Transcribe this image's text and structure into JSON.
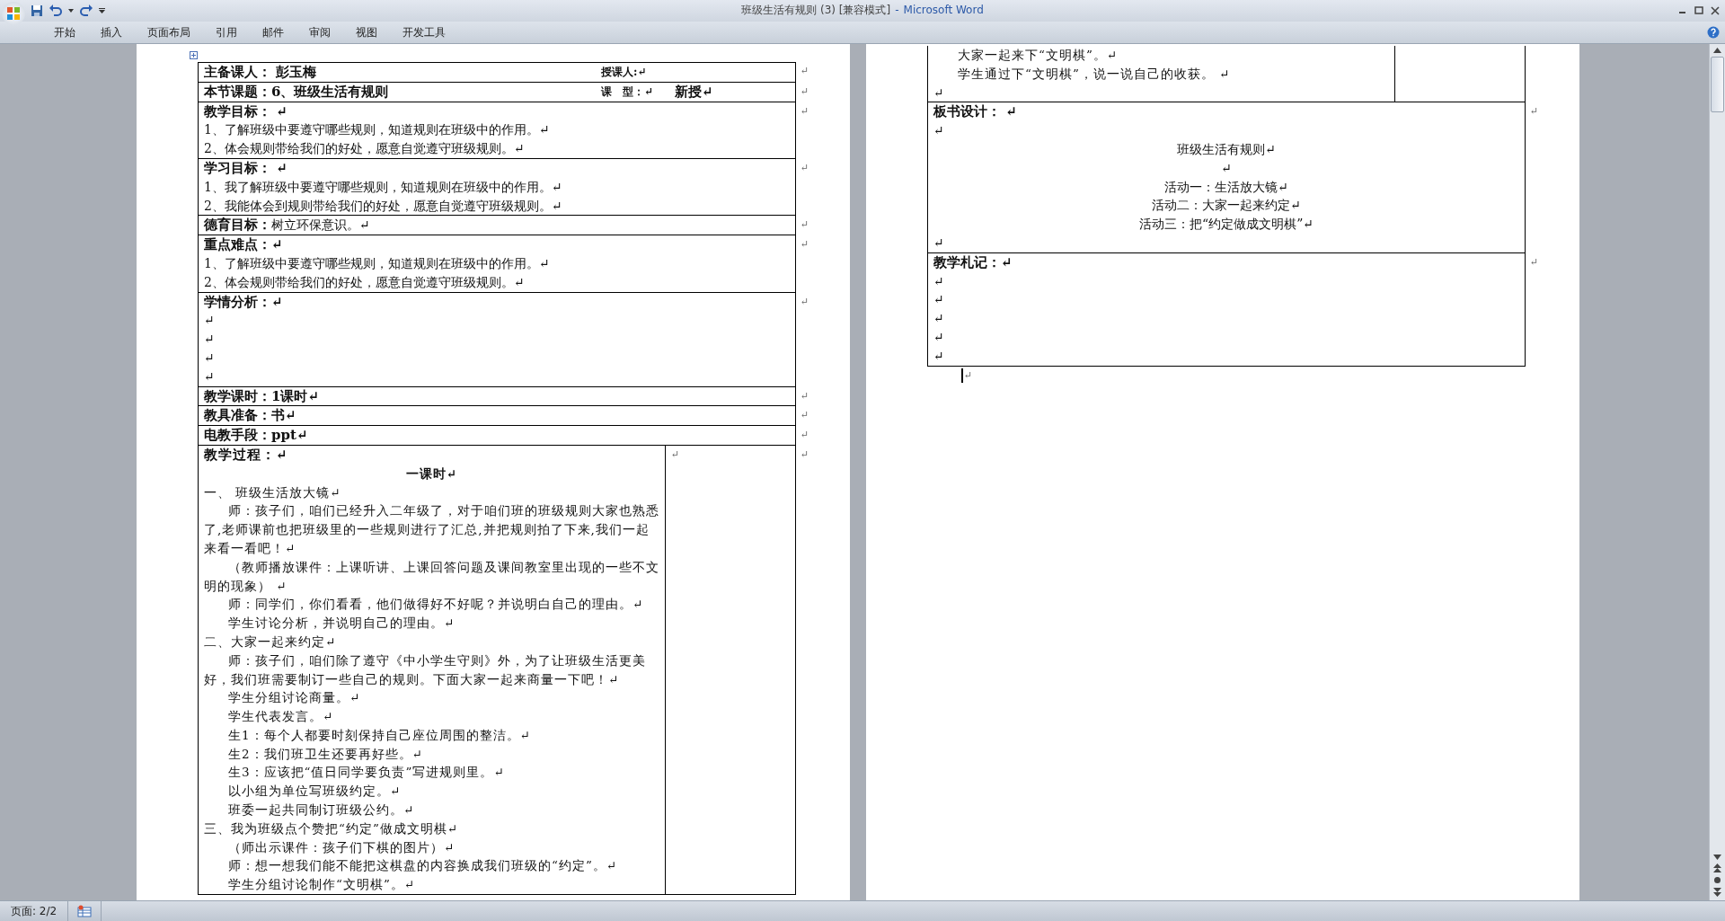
{
  "window": {
    "title": "班级生活有规则 (3) [兼容模式]",
    "separator": "-",
    "app_name": "Microsoft Word"
  },
  "ribbon_tabs": [
    "开始",
    "插入",
    "页面布局",
    "引用",
    "邮件",
    "审阅",
    "视图",
    "开发工具"
  ],
  "left_page": {
    "rows": [
      {
        "kind": "pair",
        "left": "主备课人：  彭玉梅",
        "right": [
          "授课人:↵"
        ],
        "end_mark": "↵"
      },
      {
        "kind": "pair",
        "left": "本节课题：6、班级生活有规则",
        "right": [
          "课　型：↵",
          "新授↵"
        ],
        "end_mark": "↵"
      },
      {
        "kind": "block",
        "heading": "教学目标：  ↵",
        "lines": [
          "1、了解班级中要遵守哪些规则，知道规则在班级中的作用。↵",
          "2、体会规则带给我们的好处，愿意自觉遵守班级规则。↵"
        ],
        "end_mark": "↵"
      },
      {
        "kind": "block",
        "heading": "学习目标：  ↵",
        "lines": [
          "1、我了解班级中要遵守哪些规则，知道规则在班级中的作用。↵",
          "2、我能体会到规则带给我们的好处，愿意自觉遵守班级规则。↵"
        ],
        "end_mark": "↵"
      },
      {
        "kind": "line",
        "heading": "德育目标：",
        "text": "树立环保意识。↵",
        "end_mark": "↵"
      },
      {
        "kind": "block",
        "heading": "重点难点：↵",
        "lines": [
          "1、了解班级中要遵守哪些规则，知道规则在班级中的作用。↵",
          "2、体会规则带给我们的好处，愿意自觉遵守班级规则。↵"
        ],
        "end_mark": "↵"
      },
      {
        "kind": "block",
        "heading": "学情分析：↵",
        "lines": [
          "↵",
          "↵",
          "↵",
          "↵"
        ],
        "end_mark": "↵"
      },
      {
        "kind": "line",
        "heading": "教学课时：1课时↵",
        "end_mark": "↵"
      },
      {
        "kind": "line",
        "heading": "教具准备：书↵",
        "end_mark": "↵"
      },
      {
        "kind": "line",
        "heading": "电教手段：ppt↵",
        "end_mark": "↵"
      },
      {
        "kind": "process",
        "heading": "教学过程：↵",
        "subtitle": "一课时↵",
        "side": "↵",
        "end_mark": "↵",
        "paragraphs": [
          {
            "kind": "plain",
            "text": "一、  班级生活放大镜↵"
          },
          {
            "kind": "indented",
            "text": "师：孩子们，咱们已经升入二年级了，对于咱们班的班级规则大家也熟悉了,老师课前也把班级里的一些规则进行了汇总,并把规则拍了下来,我们一起来看一看吧！↵"
          },
          {
            "kind": "indented",
            "text": "（教师播放课件：上课听讲、上课回答问题及课间教室里出现的一些不文明的现象）  ↵"
          },
          {
            "kind": "indented",
            "text": "师：同学们，你们看看，他们做得好不好呢？并说明白自己的理由。↵"
          },
          {
            "kind": "indented",
            "text": " 学生讨论分析，并说明自己的理由。↵"
          },
          {
            "kind": "plain",
            "text": "二、大家一起来约定↵"
          },
          {
            "kind": "indented",
            "text": "师：孩子们，咱们除了遵守《中小学生守则》外，为了让班级生活更美好，我们班需要制订一些自己的规则。下面大家一起来商量一下吧！↵"
          },
          {
            "kind": "indented",
            "text": "学生分组讨论商量。↵"
          },
          {
            "kind": "indented",
            "text": "学生代表发言。↵"
          },
          {
            "kind": "indented",
            "text": "生1：每个人都要时刻保持自己座位周围的整洁。↵"
          },
          {
            "kind": "indented",
            "text": "生2：我们班卫生还要再好些。↵"
          },
          {
            "kind": "indented",
            "text": "生3：应该把“值日同学要负责”写进规则里。↵"
          },
          {
            "kind": "indented",
            "text": "以小组为单位写班级约定。↵"
          },
          {
            "kind": "indented",
            "text": "班委一起共同制订班级公约。↵"
          },
          {
            "kind": "plain",
            "text": "三、我为班级点个赞把“约定”做成文明棋↵"
          },
          {
            "kind": "indented",
            "text": "（师出示课件：孩子们下棋的图片）↵"
          },
          {
            "kind": "indented",
            "text": "师：想一想我们能不能把这棋盘的内容换成我们班级的“约定”。↵"
          },
          {
            "kind": "indented",
            "text": "学生分组讨论制作“文明棋”。↵"
          }
        ]
      }
    ]
  },
  "right_page": {
    "rows": [
      {
        "kind": "process_cont",
        "paragraphs": [
          {
            "kind": "indented",
            "text": "大家一起来下“文明棋”。↵"
          },
          {
            "kind": "indented",
            "text": "学生通过下“文明棋”，说一说自己的收获。  ↵"
          },
          {
            "kind": "plain",
            "text": "↵"
          }
        ]
      },
      {
        "kind": "board",
        "heading": "板书设计：  ↵",
        "end_mark": "↵",
        "lines": [
          {
            "kind": "left",
            "text": "↵"
          },
          {
            "kind": "center",
            "text": "班级生活有规则↵"
          },
          {
            "kind": "center",
            "text": "↵"
          },
          {
            "kind": "center",
            "text": "活动一：生活放大镜↵"
          },
          {
            "kind": "center",
            "text": "活动二：大家一起来约定↵"
          },
          {
            "kind": "center",
            "text": "活动三：把“约定做成文明棋”↵"
          },
          {
            "kind": "left",
            "text": "↵"
          }
        ]
      },
      {
        "kind": "block",
        "heading": "教学札记：↵",
        "lines": [
          "↵",
          "↵",
          "↵",
          "↵",
          "↵"
        ],
        "end_mark": "↵"
      }
    ],
    "after_mark": "↵"
  },
  "status_bar": {
    "page": "页面: 2/2"
  }
}
